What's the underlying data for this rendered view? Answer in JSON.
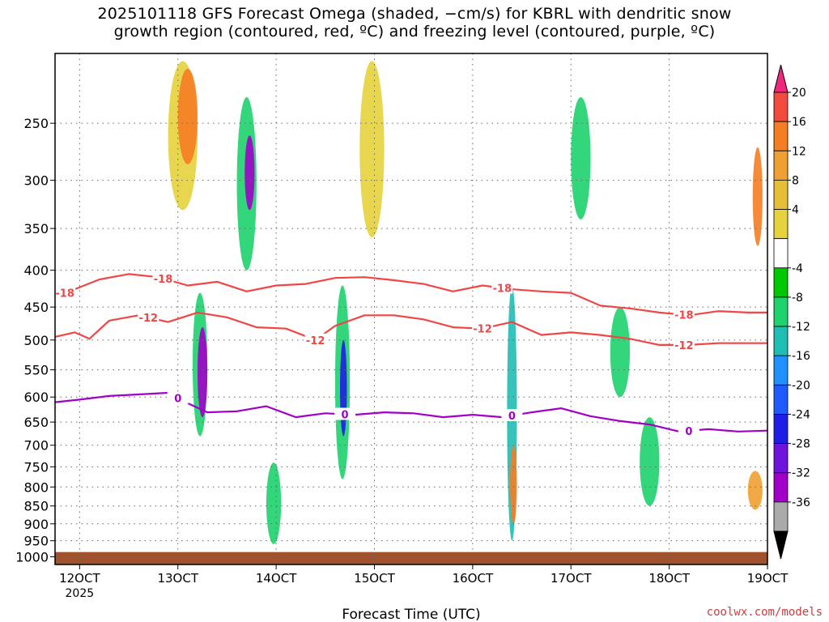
{
  "title": {
    "line1": "2025101118 GFS Forecast Omega (shaded, −cm/s) for KBRL with dendritic snow",
    "line2": "growth region (contoured, red, ºC) and freezing level (contoured, purple, ºC)"
  },
  "credit": "coolwx.com/models",
  "chart_data": {
    "type": "heatmap",
    "xlabel": "Forecast Time (UTC)",
    "x_year_label": "2025",
    "x_ticks": [
      "12OCT",
      "13OCT",
      "14OCT",
      "15OCT",
      "16OCT",
      "17OCT",
      "18OCT",
      "19OCT"
    ],
    "x_range_days": [
      11.75,
      19.0
    ],
    "y_scale": "log-pressure",
    "y_ticks": [
      250,
      300,
      350,
      400,
      450,
      500,
      550,
      600,
      650,
      700,
      750,
      800,
      850,
      900,
      950,
      1000
    ],
    "ylim_hpa": [
      200,
      1025
    ],
    "grid": true,
    "colorbar": {
      "labels": [
        "20",
        "16",
        "12",
        "8",
        "4",
        "-4",
        "-8",
        "-12",
        "-16",
        "-20",
        "-24",
        "-28",
        "-32",
        "-36"
      ],
      "colors": [
        "#f0287d",
        "#f04b3c",
        "#f57d23",
        "#f0a032",
        "#e6be37",
        "#e6d23c",
        "#ffffff",
        "#00c800",
        "#1ed26e",
        "#1ebeb4",
        "#1e91ff",
        "#1e5aff",
        "#1e1ee6",
        "#6e14dc",
        "#a000c8",
        "#aaaaaa",
        "#000000"
      ]
    },
    "ground_color": "#a0522d",
    "contours": [
      {
        "label": "-18",
        "color": "#f04646",
        "x": [
          11.75,
          11.95,
          12.2,
          12.5,
          12.8,
          13.1,
          13.4,
          13.7,
          14.0,
          14.3,
          14.6,
          14.9,
          15.2,
          15.5,
          15.8,
          16.1,
          16.4,
          16.7,
          17.0,
          17.3,
          17.6,
          17.9,
          18.2,
          18.5,
          18.8,
          19.0
        ],
        "y": [
          435,
          425,
          412,
          405,
          409,
          420,
          415,
          428,
          420,
          418,
          410,
          409,
          413,
          418,
          428,
          420,
          425,
          428,
          430,
          448,
          452,
          458,
          462,
          456,
          458,
          458
        ],
        "label_x": [
          11.85,
          12.85,
          16.3,
          18.15
        ]
      },
      {
        "label": "-12",
        "color": "#f04646",
        "x": [
          11.75,
          11.95,
          12.1,
          12.3,
          12.6,
          12.9,
          13.2,
          13.5,
          13.8,
          14.1,
          14.4,
          14.6,
          14.9,
          15.2,
          15.5,
          15.8,
          16.1,
          16.4,
          16.7,
          17.0,
          17.3,
          17.6,
          17.9,
          18.2,
          18.5,
          18.8,
          19.0
        ],
        "y": [
          495,
          488,
          498,
          470,
          462,
          472,
          458,
          465,
          480,
          482,
          500,
          478,
          462,
          462,
          468,
          480,
          482,
          472,
          492,
          488,
          492,
          498,
          508,
          508,
          505,
          505,
          505
        ],
        "label_x": [
          12.7,
          14.4,
          16.1,
          18.15
        ]
      },
      {
        "label": "0",
        "color": "#a000c8",
        "x": [
          11.75,
          12.0,
          12.3,
          12.6,
          12.9,
          13.1,
          13.3,
          13.6,
          13.9,
          14.2,
          14.5,
          14.8,
          15.1,
          15.4,
          15.7,
          16.0,
          16.3,
          16.6,
          16.9,
          17.2,
          17.5,
          17.8,
          18.1,
          18.4,
          18.7,
          19.0
        ],
        "y": [
          610,
          605,
          598,
          595,
          592,
          612,
          630,
          628,
          618,
          640,
          632,
          635,
          630,
          632,
          640,
          635,
          640,
          630,
          622,
          638,
          648,
          655,
          670,
          665,
          670,
          668
        ],
        "label_x": [
          13.0,
          14.7,
          16.4,
          18.2
        ]
      }
    ],
    "omega_regions": [
      {
        "x": [
          12.9,
          13.2
        ],
        "p": [
          205,
          330
        ],
        "value": 6
      },
      {
        "x": [
          13.0,
          13.2
        ],
        "p": [
          210,
          285
        ],
        "value": 13
      },
      {
        "x": [
          13.15,
          13.3
        ],
        "p": [
          430,
          680
        ],
        "value": -10
      },
      {
        "x": [
          13.2,
          13.3
        ],
        "p": [
          480,
          640
        ],
        "value": -28
      },
      {
        "x": [
          13.6,
          13.8
        ],
        "p": [
          230,
          400
        ],
        "value": -10
      },
      {
        "x": [
          13.68,
          13.78
        ],
        "p": [
          260,
          330
        ],
        "value": -28
      },
      {
        "x": [
          13.9,
          14.05
        ],
        "p": [
          740,
          960
        ],
        "value": -10
      },
      {
        "x": [
          14.6,
          14.75
        ],
        "p": [
          420,
          780
        ],
        "value": -10
      },
      {
        "x": [
          14.65,
          14.72
        ],
        "p": [
          500,
          680
        ],
        "value": -24
      },
      {
        "x": [
          14.85,
          15.1
        ],
        "p": [
          205,
          360
        ],
        "value": 6
      },
      {
        "x": [
          16.35,
          16.45
        ],
        "p": [
          420,
          950
        ],
        "value": -12
      },
      {
        "x": [
          16.38,
          16.45
        ],
        "p": [
          700,
          900
        ],
        "value": 14
      },
      {
        "x": [
          17.0,
          17.2
        ],
        "p": [
          230,
          340
        ],
        "value": -10
      },
      {
        "x": [
          17.4,
          17.6
        ],
        "p": [
          450,
          600
        ],
        "value": -10
      },
      {
        "x": [
          17.7,
          17.9
        ],
        "p": [
          640,
          850
        ],
        "value": -10
      },
      {
        "x": [
          18.85,
          18.95
        ],
        "p": [
          270,
          370
        ],
        "value": 12
      },
      {
        "x": [
          18.8,
          18.95
        ],
        "p": [
          760,
          860
        ],
        "value": 9
      }
    ]
  }
}
